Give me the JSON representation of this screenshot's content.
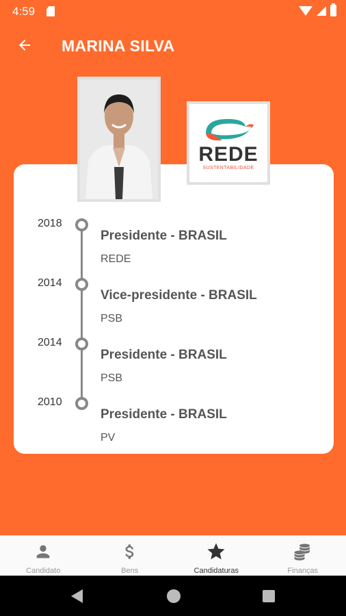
{
  "status_bar": {
    "time": "4:59"
  },
  "app_bar": {
    "title": "MARINA SILVA"
  },
  "party_logo": {
    "name": "REDE",
    "subtitle": "SUSTENTABILIDADE"
  },
  "timeline": [
    {
      "year": "2018",
      "office": "Presidente - BRASIL",
      "party": "REDE"
    },
    {
      "year": "2014",
      "office": "Vice-presidente - BRASIL",
      "party": "PSB"
    },
    {
      "year": "2014",
      "office": "Presidente - BRASIL",
      "party": "PSB"
    },
    {
      "year": "2010",
      "office": "Presidente - BRASIL",
      "party": "PV"
    }
  ],
  "bottom_nav": {
    "items": [
      {
        "label": "Candidato",
        "icon": "person-icon"
      },
      {
        "label": "Bens",
        "icon": "dollar-icon"
      },
      {
        "label": "Candidaturas",
        "icon": "star-icon",
        "active": true
      },
      {
        "label": "Finanças",
        "icon": "coins-icon"
      }
    ]
  },
  "colors": {
    "accent": "#FF6B2C",
    "card": "#FFFFFF",
    "timeline": "#888888"
  }
}
